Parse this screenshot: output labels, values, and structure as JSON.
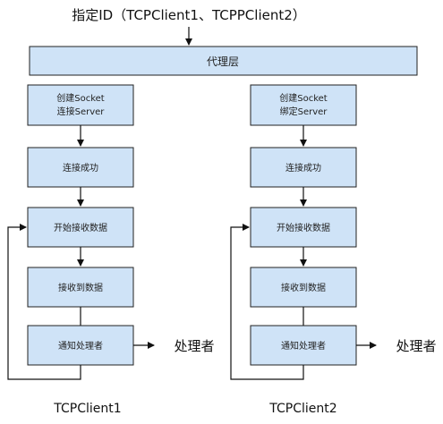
{
  "top_label": "指定ID（TCPClient1、TCPPClient2）",
  "proxy_layer": "代理层",
  "client1": {
    "name": "TCPClient1",
    "steps": [
      [
        "创建Socket",
        "连接Server"
      ],
      [
        "连接成功"
      ],
      [
        "开始接收数据"
      ],
      [
        "接收到数据"
      ],
      [
        "通知处理者"
      ]
    ],
    "handler": "处理者"
  },
  "client2": {
    "name": "TCPClient2",
    "steps": [
      [
        "创建Socket",
        "绑定Server"
      ],
      [
        "连接成功"
      ],
      [
        "开始接收数据"
      ],
      [
        "接收到数据"
      ],
      [
        "通知处理者"
      ]
    ],
    "handler": "处理者"
  },
  "colors": {
    "box_fill": "#cfe3f7",
    "stroke": "#222222"
  }
}
